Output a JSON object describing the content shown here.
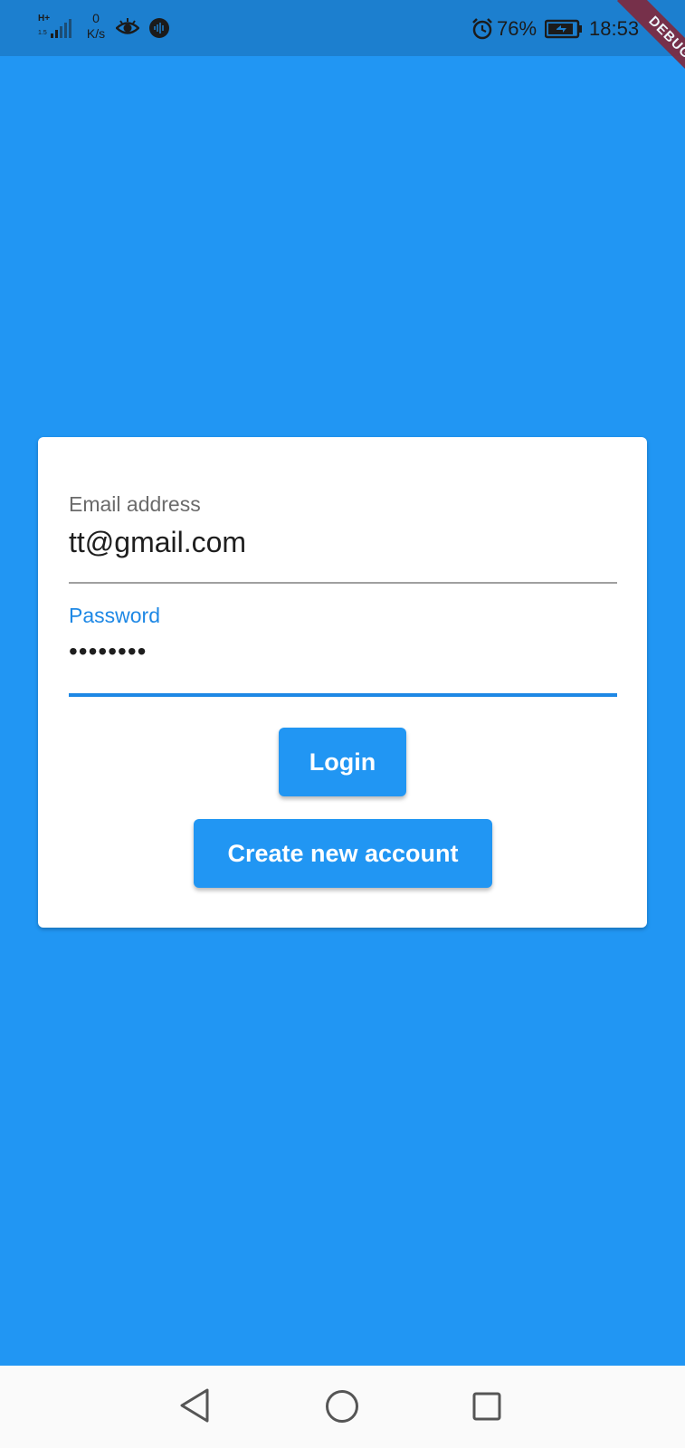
{
  "status_bar": {
    "network_type": "H+",
    "network_sub": "1.5",
    "speed_value": "0",
    "speed_unit": "K/s",
    "battery_percent": "76%",
    "time": "18:53",
    "icons": [
      "signal-icon",
      "eye-icon",
      "waves-icon",
      "alarm-icon",
      "battery-icon"
    ]
  },
  "debug_banner": "DEBUG",
  "login_form": {
    "email": {
      "label": "Email address",
      "value": "tt@gmail.com"
    },
    "password": {
      "label": "Password",
      "value": "••••••••"
    },
    "login_button": "Login",
    "create_account_button": "Create new account"
  },
  "nav_bar": {
    "icons": [
      "back-icon",
      "home-icon",
      "recent-apps-icon"
    ]
  },
  "colors": {
    "background": "#2196f3",
    "status_bar": "#1c7fcf",
    "accent": "#1e88e5",
    "card": "#ffffff",
    "debug_ribbon": "#7e2a3f"
  }
}
